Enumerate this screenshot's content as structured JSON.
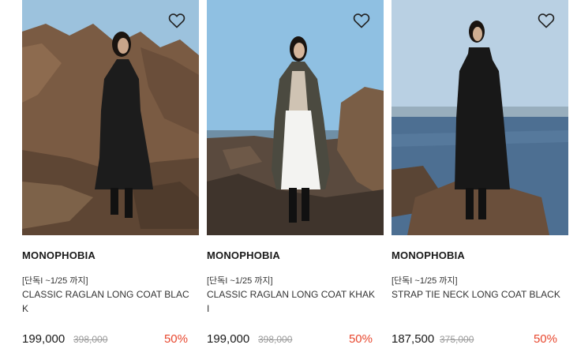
{
  "products": [
    {
      "brand": "MONOPHOBIA",
      "promo": "[단독I ~1/25 까지]",
      "name": "CLASSIC RAGLAN LONG COAT BLACK",
      "price": "199,000",
      "original_price": "398,000",
      "discount": "50%",
      "coat_color": "#1c1c1c"
    },
    {
      "brand": "MONOPHOBIA",
      "promo": "[단독I ~1/25 까지]",
      "name": "CLASSIC RAGLAN LONG COAT KHAKI",
      "price": "199,000",
      "original_price": "398,000",
      "discount": "50%",
      "coat_color": "#4b4a40"
    },
    {
      "brand": "MONOPHOBIA",
      "promo": "[단독I ~1/25 까지]",
      "name": "STRAP TIE NECK LONG COAT BLACK",
      "price": "187,500",
      "original_price": "375,000",
      "discount": "50%",
      "coat_color": "#181818"
    }
  ],
  "icons": {
    "wishlist": "heart-outline-icon"
  },
  "colors": {
    "discount": "#e8472e",
    "original_price": "#9a9a9a"
  }
}
